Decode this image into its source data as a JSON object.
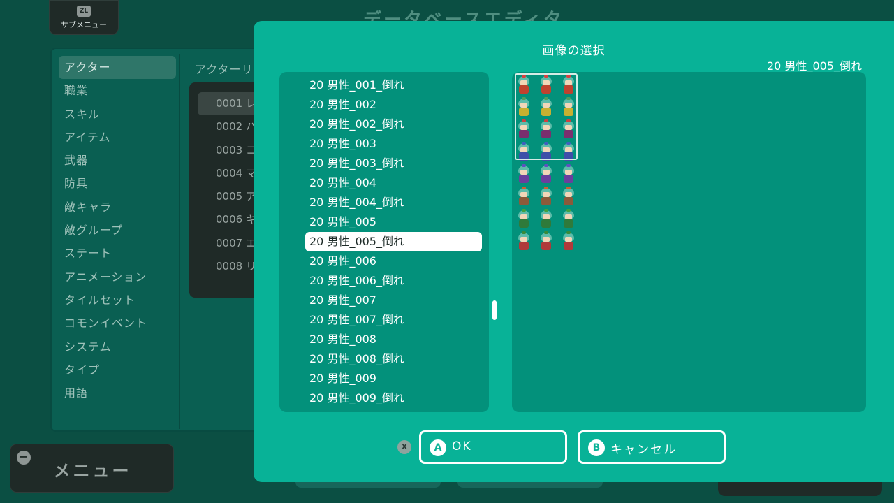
{
  "submenu": {
    "badge": "ZL",
    "label": "サブメニュー"
  },
  "background_title": "データベースエディタ",
  "categories": [
    "アクター",
    "職業",
    "スキル",
    "アイテム",
    "武器",
    "防具",
    "敵キャラ",
    "敵グループ",
    "ステート",
    "アニメーション",
    "タイルセット",
    "コモンイベント",
    "システム",
    "タイプ",
    "用語"
  ],
  "active_category": "アクター",
  "actor_list_title": "アクターリスト",
  "actors": [
    "0001 レ",
    "0002 ハ",
    "0003 コ",
    "0004 マ",
    "0005 ア",
    "0006 キ",
    "0007 エ",
    "0008 リ"
  ],
  "menu": {
    "badge": "−",
    "label": "メニュー"
  },
  "dialog": {
    "title": "画像の選択",
    "selected_name": "20 男性_005_倒れ",
    "files": [
      "20 男性_001_倒れ",
      "20 男性_002",
      "20 男性_002_倒れ",
      "20 男性_003",
      "20 男性_003_倒れ",
      "20 男性_004",
      "20 男性_004_倒れ",
      "20 男性_005",
      "20 男性_005_倒れ",
      "20 男性_006",
      "20 男性_006_倒れ",
      "20 男性_007",
      "20 男性_007_倒れ",
      "20 男性_008",
      "20 男性_008_倒れ",
      "20 男性_009",
      "20 男性_009_倒れ"
    ],
    "selected_index": 8,
    "x_badge": "X",
    "ok": {
      "badge": "A",
      "label": "OK"
    },
    "cancel": {
      "badge": "B",
      "label": "キャンセル"
    }
  },
  "colors": {
    "dialog_bg": "#08b297",
    "panel_bg": "#03917b",
    "page_bg": "#0b4f43"
  }
}
